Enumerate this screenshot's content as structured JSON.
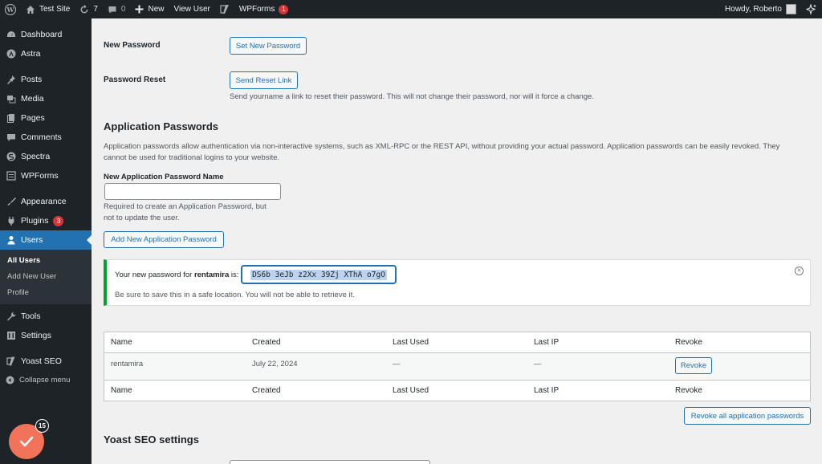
{
  "adminbar": {
    "site_name": "Test Site",
    "updates_count": "7",
    "comments_count": "0",
    "new_label": "New",
    "view_user_label": "View User",
    "wpforms_label": "WPForms",
    "wpforms_badge": "1",
    "greeting": "Howdy, Roberto"
  },
  "sidebar": {
    "items": [
      {
        "label": "Dashboard",
        "icon": "dashboard-icon"
      },
      {
        "label": "Astra",
        "icon": "astra-icon"
      },
      {
        "label": "Posts",
        "icon": "pin-icon"
      },
      {
        "label": "Media",
        "icon": "media-icon"
      },
      {
        "label": "Pages",
        "icon": "page-icon"
      },
      {
        "label": "Comments",
        "icon": "comment-icon"
      },
      {
        "label": "Spectra",
        "icon": "spectra-icon"
      },
      {
        "label": "WPForms",
        "icon": "wpforms-icon"
      },
      {
        "label": "Appearance",
        "icon": "brush-icon"
      },
      {
        "label": "Plugins",
        "icon": "plug-icon",
        "badge": "3"
      },
      {
        "label": "Users",
        "icon": "user-icon"
      },
      {
        "label": "Tools",
        "icon": "wrench-icon"
      },
      {
        "label": "Settings",
        "icon": "settings-icon"
      },
      {
        "label": "Yoast SEO",
        "icon": "yoast-icon"
      }
    ],
    "users_submenu": [
      "All Users",
      "Add New User",
      "Profile"
    ],
    "collapse_label": "Collapse menu",
    "fab_badge": "15"
  },
  "main": {
    "new_password_label": "New Password",
    "set_new_password_button": "Set New Password",
    "password_reset_label": "Password Reset",
    "send_reset_link_button": "Send Reset Link",
    "password_reset_desc": "Send yourname a link to reset their password. This will not change their password, nor will it force a change.",
    "app_passwords_heading": "Application Passwords",
    "app_passwords_desc": "Application passwords allow authentication via non-interactive systems, such as XML-RPC or the REST API, without providing your actual password. Application passwords can be easily revoked. They cannot be used for traditional logins to your website.",
    "new_app_pw_name_label": "New Application Password Name",
    "new_app_pw_name_value": "",
    "new_app_pw_help": "Required to create an Application Password, but not to update the user.",
    "add_new_app_pw_button": "Add New Application Password",
    "notice": {
      "prefix": "Your new password for ",
      "username": "rentamira",
      "suffix": " is:",
      "password": "DS6b 3eJb z2Xx 39Zj XThA o7gO",
      "warning": "Be sure to save this in a safe location. You will not be able to retrieve it."
    },
    "table": {
      "headers": [
        "Name",
        "Created",
        "Last Used",
        "Last IP",
        "Revoke"
      ],
      "rows": [
        {
          "name": "rentamira",
          "created": "July 22, 2024",
          "last_used": "—",
          "last_ip": "—",
          "revoke": "Revoke"
        }
      ]
    },
    "revoke_all_button": "Revoke all application passwords",
    "yoast_heading": "Yoast SEO settings"
  }
}
